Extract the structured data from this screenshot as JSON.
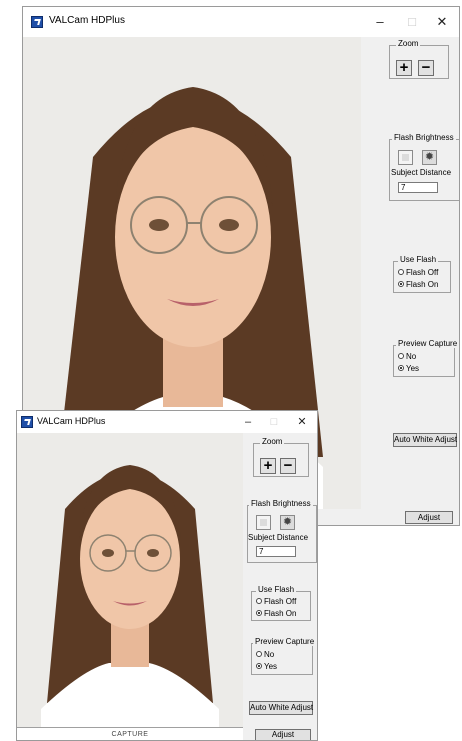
{
  "window": {
    "title": "VALCam HDPlus",
    "minimize_glyph": "–",
    "maximize_glyph": "□",
    "close_glyph": "✕"
  },
  "zoom": {
    "label": "Zoom",
    "plus": "+",
    "minus": "−"
  },
  "flash_brightness": {
    "label": "Flash Brightness",
    "sun_glyph": "✹"
  },
  "subject_distance": {
    "label": "Subject Distance",
    "value": "7"
  },
  "use_flash": {
    "label": "Use Flash",
    "options": [
      "Flash Off",
      "Flash On"
    ],
    "selected": "Flash On"
  },
  "preview_capture": {
    "label": "Preview Capture",
    "options": [
      "No",
      "Yes"
    ],
    "selected": "Yes"
  },
  "buttons": {
    "auto_white": "Auto White Adjust",
    "adjust": "Adjust",
    "capture": "CAPTURE"
  },
  "icons": [
    "app-icon",
    "minimize-icon",
    "maximize-icon",
    "close-icon",
    "zoom-in-icon",
    "zoom-out-icon",
    "flash-dim-icon",
    "flash-bright-icon"
  ],
  "colors": {
    "window_bg": "#f0f0f0",
    "titlebar_bg": "#ffffff",
    "button_bg": "#e1e1e1",
    "photo_bg": "#ecebe8"
  }
}
